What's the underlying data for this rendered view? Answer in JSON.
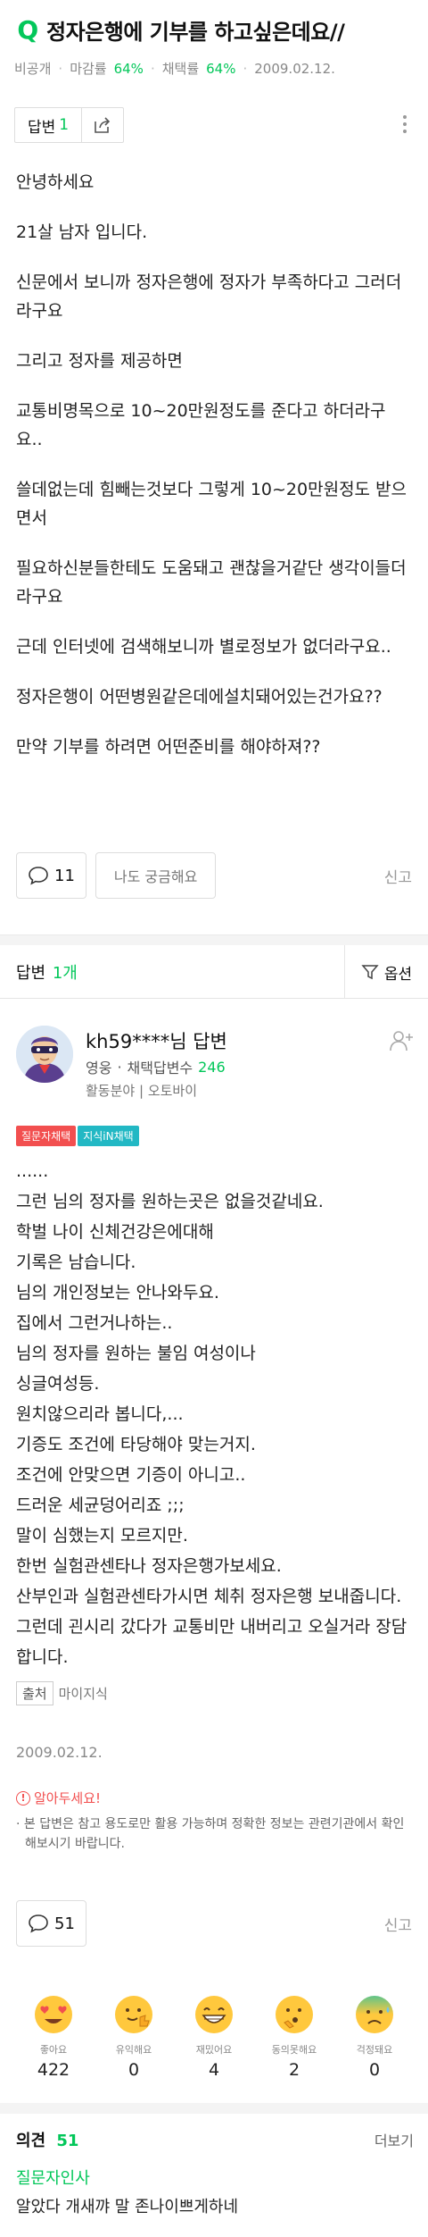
{
  "question": {
    "mark": "Q",
    "title": "정자은행에 기부를 하고싶은데요//",
    "meta": {
      "visibility": "비공개",
      "close_label": "마감률",
      "close_rate": "64%",
      "adopt_label": "채택률",
      "adopt_rate": "64%",
      "date": "2009.02.12."
    },
    "answer_button": {
      "label": "답변",
      "count": "1"
    },
    "paragraphs": [
      "안녕하세요",
      "21살 남자 입니다.",
      "신문에서 보니까 정자은행에 정자가 부족하다고 그러더라구요",
      "그리고 정자를 제공하면",
      "교통비명목으로 10~20만원정도를 준다고 하더라구요..",
      "쓸데없는데 힘빼는것보다 그렇게 10~20만원정도 받으면서",
      "필요하신분들한테도 도움돼고 괜찮을거같단 생각이들더라구요",
      "근데 인터넷에 검색해보니까 별로정보가 없더라구요..",
      "정자은행이 어떤병원같은데에설치돼어있는건가요??",
      "만약 기부를 하려면 어떤준비를 해야하져??"
    ],
    "comment_count": "11",
    "curious_label": "나도 궁금해요",
    "report_label": "신고"
  },
  "answers_header": {
    "label": "답변",
    "count": "1개",
    "options_label": "옵션"
  },
  "answer": {
    "author": "kh59****님 답변",
    "level": "영웅",
    "adopt_label": "채택답변수",
    "adopt_count": "246",
    "field_label": "활동분야",
    "field_value": "오토바이",
    "badges": [
      "질문자채택",
      "지식iN채택"
    ],
    "lines": [
      "......",
      "그런 님의 정자를 원하는곳은 없을것같네요.",
      "학벌 나이 신체건강은에대해",
      "기록은 남습니다.",
      "님의 개인정보는 안나와두요.",
      "집에서 그런거나하는..",
      "님의 정자를 원하는 불임 여성이나",
      "싱글여성등.",
      "원치않으리라 봅니다,...",
      "기증도 조건에 타당해야 맞는거지.",
      "조건에 안맞으면 기증이 아니고..",
      "드러운 세균덩어리죠 ;;;",
      "말이 심했는지 모르지만.",
      "한번 실험관센타나 정자은행가보세요.",
      "산부인과 실험관센타가시면 체취 정자은행 보내줍니다.",
      "그런데 괸시리 갔다가 교통비만 내버리고 오실거라 장담합니다."
    ],
    "source_label": "출처",
    "source_value": "마이지식",
    "date": "2009.02.12.",
    "notice_title": "알아두세요!",
    "notice_text": "· 본 답변은 참고 용도로만 활용 가능하며 정확한 정보는 관련기관에서 확인해보시기 바랍니다.",
    "comment_count": "51",
    "report_label": "신고",
    "reactions": [
      {
        "label": "좋아요",
        "count": "422",
        "icon": "heart-eyes-icon"
      },
      {
        "label": "유익해요",
        "count": "0",
        "icon": "thumbs-up-face-icon"
      },
      {
        "label": "재밌어요",
        "count": "4",
        "icon": "grin-icon"
      },
      {
        "label": "동의못해요",
        "count": "2",
        "icon": "thinking-face-icon"
      },
      {
        "label": "걱정돼요",
        "count": "0",
        "icon": "worried-face-icon"
      }
    ]
  },
  "opinions": {
    "label": "의견",
    "count": "51",
    "more_label": "더보기",
    "first_user": "질문자인사",
    "first_text": "알았다 개새꺄 말 존나이쁘게하네"
  },
  "colors": {
    "accent": "#03c75a",
    "alert": "#f24f4f",
    "teal": "#22b8c4"
  }
}
